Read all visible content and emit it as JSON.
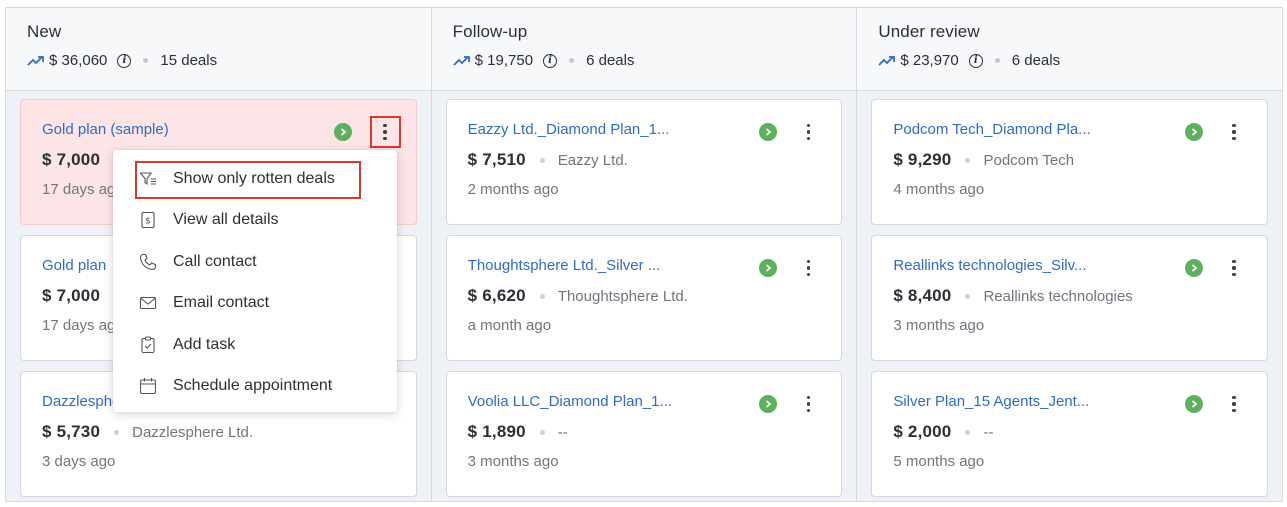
{
  "columns": [
    {
      "title": "New",
      "total": "$ 36,060",
      "deals": "15 deals",
      "cards": [
        {
          "title": "Gold plan (sample)",
          "amount": "$ 7,000",
          "org": "",
          "age": "17 days ago",
          "rotten": true
        },
        {
          "title": "Gold plan",
          "amount": "$ 7,000",
          "org": "",
          "age": "17 days ago",
          "rotten": false
        },
        {
          "title": "Dazzlesphere",
          "amount": "$ 5,730",
          "org": "Dazzlesphere Ltd.",
          "age": "3 days ago",
          "rotten": false
        }
      ]
    },
    {
      "title": "Follow-up",
      "total": "$ 19,750",
      "deals": "6 deals",
      "cards": [
        {
          "title": "Eazzy Ltd._Diamond Plan_1...",
          "amount": "$ 7,510",
          "org": "Eazzy Ltd.",
          "age": "2 months ago"
        },
        {
          "title": "Thoughtsphere Ltd._Silver ...",
          "amount": "$ 6,620",
          "org": "Thoughtsphere Ltd.",
          "age": "a month ago"
        },
        {
          "title": "Voolia LLC_Diamond Plan_1...",
          "amount": "$ 1,890",
          "org": "--",
          "age": "3 months ago"
        }
      ]
    },
    {
      "title": "Under review",
      "total": "$ 23,970",
      "deals": "6 deals",
      "cards": [
        {
          "title": "Podcom Tech_Diamond Pla...",
          "amount": "$ 9,290",
          "org": "Podcom Tech",
          "age": "4 months ago"
        },
        {
          "title": "Reallinks technologies_Silv...",
          "amount": "$ 8,400",
          "org": "Reallinks technologies",
          "age": "3 months ago"
        },
        {
          "title": "Silver Plan_15 Agents_Jent...",
          "amount": "$ 2,000",
          "org": "--",
          "age": "5 months ago"
        }
      ]
    }
  ],
  "menu": {
    "items": [
      {
        "label": "Show only rotten deals",
        "icon": "filter-icon"
      },
      {
        "label": "View all details",
        "icon": "dollar-doc-icon"
      },
      {
        "label": "Call contact",
        "icon": "phone-icon"
      },
      {
        "label": "Email contact",
        "icon": "envelope-icon"
      },
      {
        "label": "Add task",
        "icon": "clipboard-check-icon"
      },
      {
        "label": "Schedule appointment",
        "icon": "calendar-icon"
      }
    ]
  },
  "colors": {
    "link": "#2e6bc7",
    "status_green": "#5db15d",
    "highlight_red": "#d8392f",
    "rotten_bg": "#fde4e6"
  }
}
